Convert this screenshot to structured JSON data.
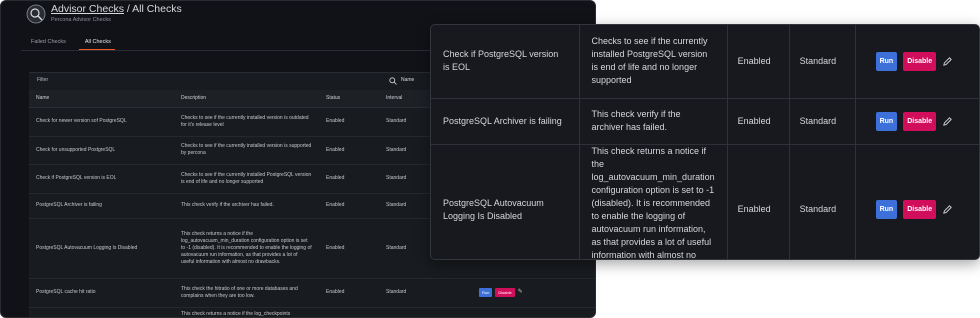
{
  "header": {
    "title_link": "Advisor Checks",
    "title_rest": " / All Checks",
    "subtitle": "Percona Advisor Checks"
  },
  "tabs": [
    {
      "label": "Failed Checks",
      "active": false
    },
    {
      "label": "All Checks",
      "active": true
    }
  ],
  "filter": {
    "label": "Filter",
    "search_value": "Name"
  },
  "table": {
    "columns": [
      "Name",
      "Description",
      "Status",
      "Interval"
    ],
    "rows": [
      {
        "name": "Check for newer version sof PostgreSQL",
        "description": "Checks to see if the currently installed version is outdated for it's release level",
        "status": "Enabled",
        "interval": "Standard"
      },
      {
        "name": "Check for unsupported PostgreSQL",
        "description": "Checks to see if the currently installed version is supported by percona",
        "status": "Enabled",
        "interval": "Standard"
      },
      {
        "name": "Check if PostgreSQL version is EOL",
        "description": "Checks to see if the currently installed PostgreSQL version is end of life and no longer supported",
        "status": "Enabled",
        "interval": "Standard"
      },
      {
        "name": "PostgreSQL Archiver is failing",
        "description": "This check verify if the archiver has failed.",
        "status": "Enabled",
        "interval": "Standard"
      },
      {
        "name": "PostgreSQL Autovacuum Logging Is Disabled",
        "description": "This check returns a notice if the log_autovacuum_min_duration configuration option is set to -1 (disabled). It is recommended to enable the logging of autovacuum run information, as that provides a lot of useful information with almost no drawbacks.",
        "status": "Enabled",
        "interval": "Standard"
      },
      {
        "name": "PostgreSQL cache hit ratio",
        "description": "This check the hitratio of one or more databases and complains when they are too low.",
        "status": "Enabled",
        "interval": "Standard",
        "has_actions": true
      },
      {
        "name": "",
        "description": "This check returns a notice if the log_checkpoints",
        "status": "",
        "interval": ""
      }
    ]
  },
  "actions": {
    "run_label": "Run",
    "disable_label": "Disable",
    "edit_icon": "pencil-icon"
  },
  "zoom": {
    "rows": [
      {
        "name": "Check if PostgreSQL version is EOL",
        "description": "Checks to see if the currently installed PostgreSQL version is end of life and no longer supported",
        "status": "Enabled",
        "interval": "Standard"
      },
      {
        "name": "PostgreSQL Archiver is failing",
        "description": "This check verify if the archiver has failed.",
        "status": "Enabled",
        "interval": "Standard"
      },
      {
        "name": "PostgreSQL Autovacuum Logging Is Disabled",
        "description": "This check returns a notice if the log_autovacuum_min_duration configuration option is set to -1 (disabled). It is recommended to enable the logging of autovacuum run information, as that provides a lot of useful information with almost no drawbacks.",
        "status": "Enabled",
        "interval": "Standard"
      }
    ]
  },
  "colors": {
    "background": "#111217",
    "accent_tab": "#f05a28",
    "run_button": "#3d71d9",
    "disable_button": "#d10e5c"
  }
}
